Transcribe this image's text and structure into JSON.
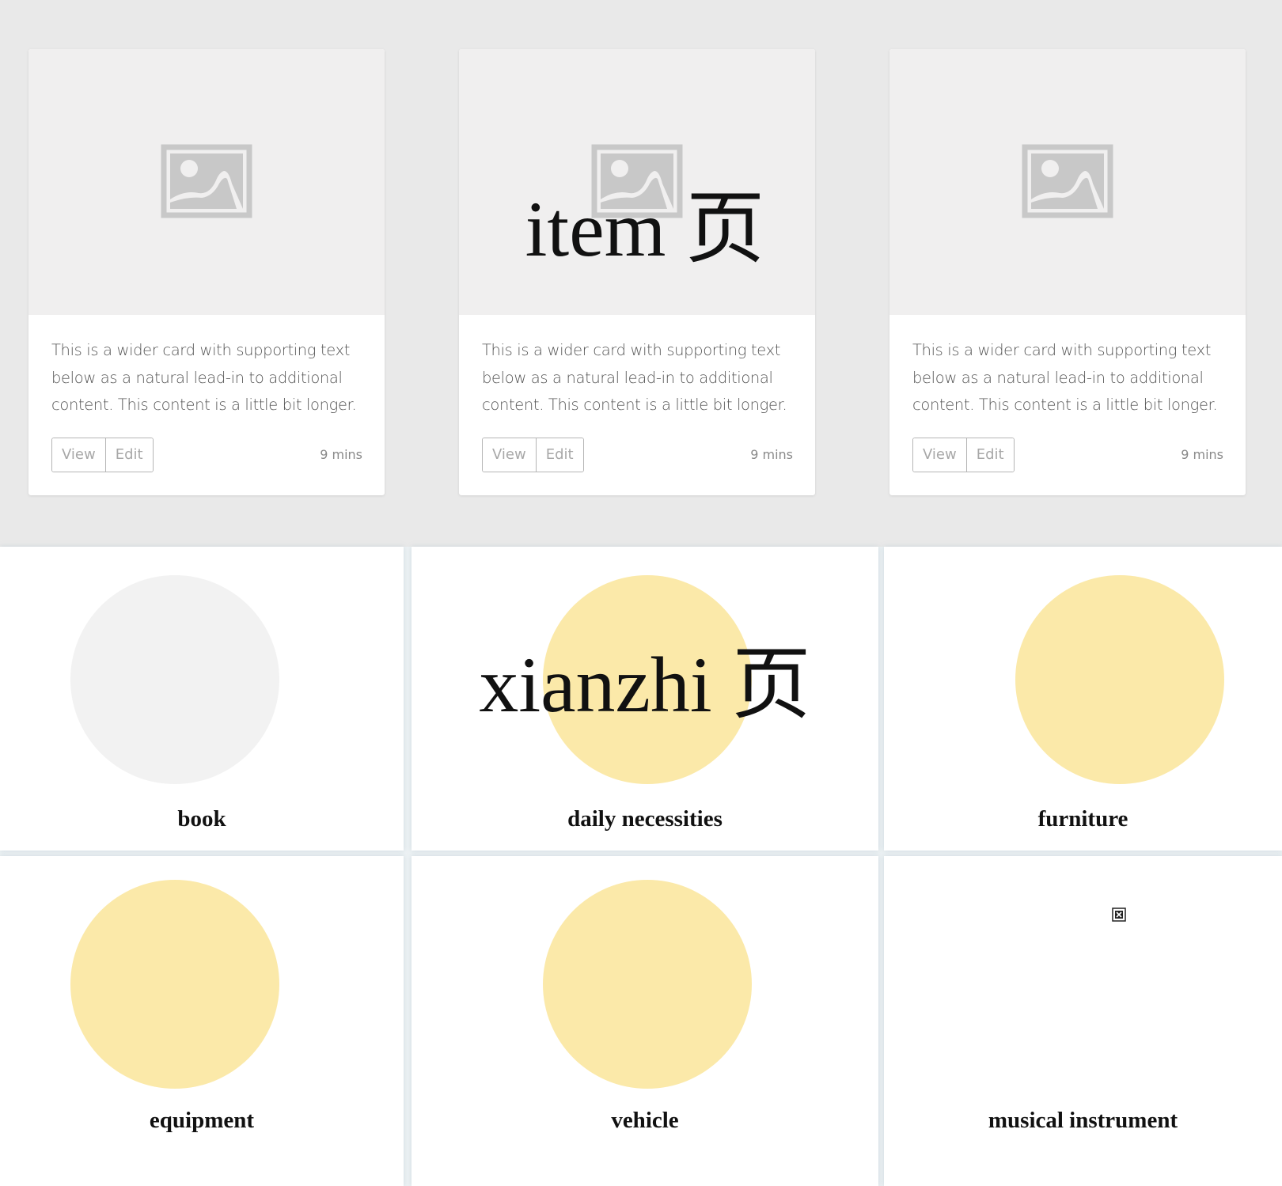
{
  "album": {
    "cards": [
      {
        "text": "This is a wider card with supporting text below as a natural lead-in to additional content. This content is a little bit longer.",
        "view_label": "View",
        "edit_label": "Edit",
        "time": "9 mins",
        "overlay": ""
      },
      {
        "text": "This is a wider card with supporting text below as a natural lead-in to additional content. This content is a little bit longer.",
        "view_label": "View",
        "edit_label": "Edit",
        "time": "9 mins",
        "overlay": "item 页"
      },
      {
        "text": "This is a wider card with supporting text below as a natural lead-in to additional content. This content is a little bit longer.",
        "view_label": "View",
        "edit_label": "Edit",
        "time": "9 mins",
        "overlay": ""
      }
    ]
  },
  "categories": {
    "overlay": "xianzhi 页",
    "items": [
      {
        "label": "book",
        "circle_color": "#f2f2f2",
        "image": "circle"
      },
      {
        "label": "daily necessities",
        "circle_color": "#fbe9a9",
        "image": "circle"
      },
      {
        "label": "furniture",
        "circle_color": "#fbe9a9",
        "image": "circle"
      },
      {
        "label": "equipment",
        "circle_color": "#fbe9a9",
        "image": "circle"
      },
      {
        "label": "vehicle",
        "circle_color": "#fbe9a9",
        "image": "circle"
      },
      {
        "label": "musical instrument",
        "circle_color": "",
        "image": "broken-image-icon"
      }
    ]
  },
  "colors": {
    "album_background": "#e9e9e9",
    "thumb_background": "#f0efef",
    "placeholder_icon": "#c8c8c8",
    "circle_gray": "#f2f2f2",
    "circle_yellow": "#fbe9a9"
  }
}
